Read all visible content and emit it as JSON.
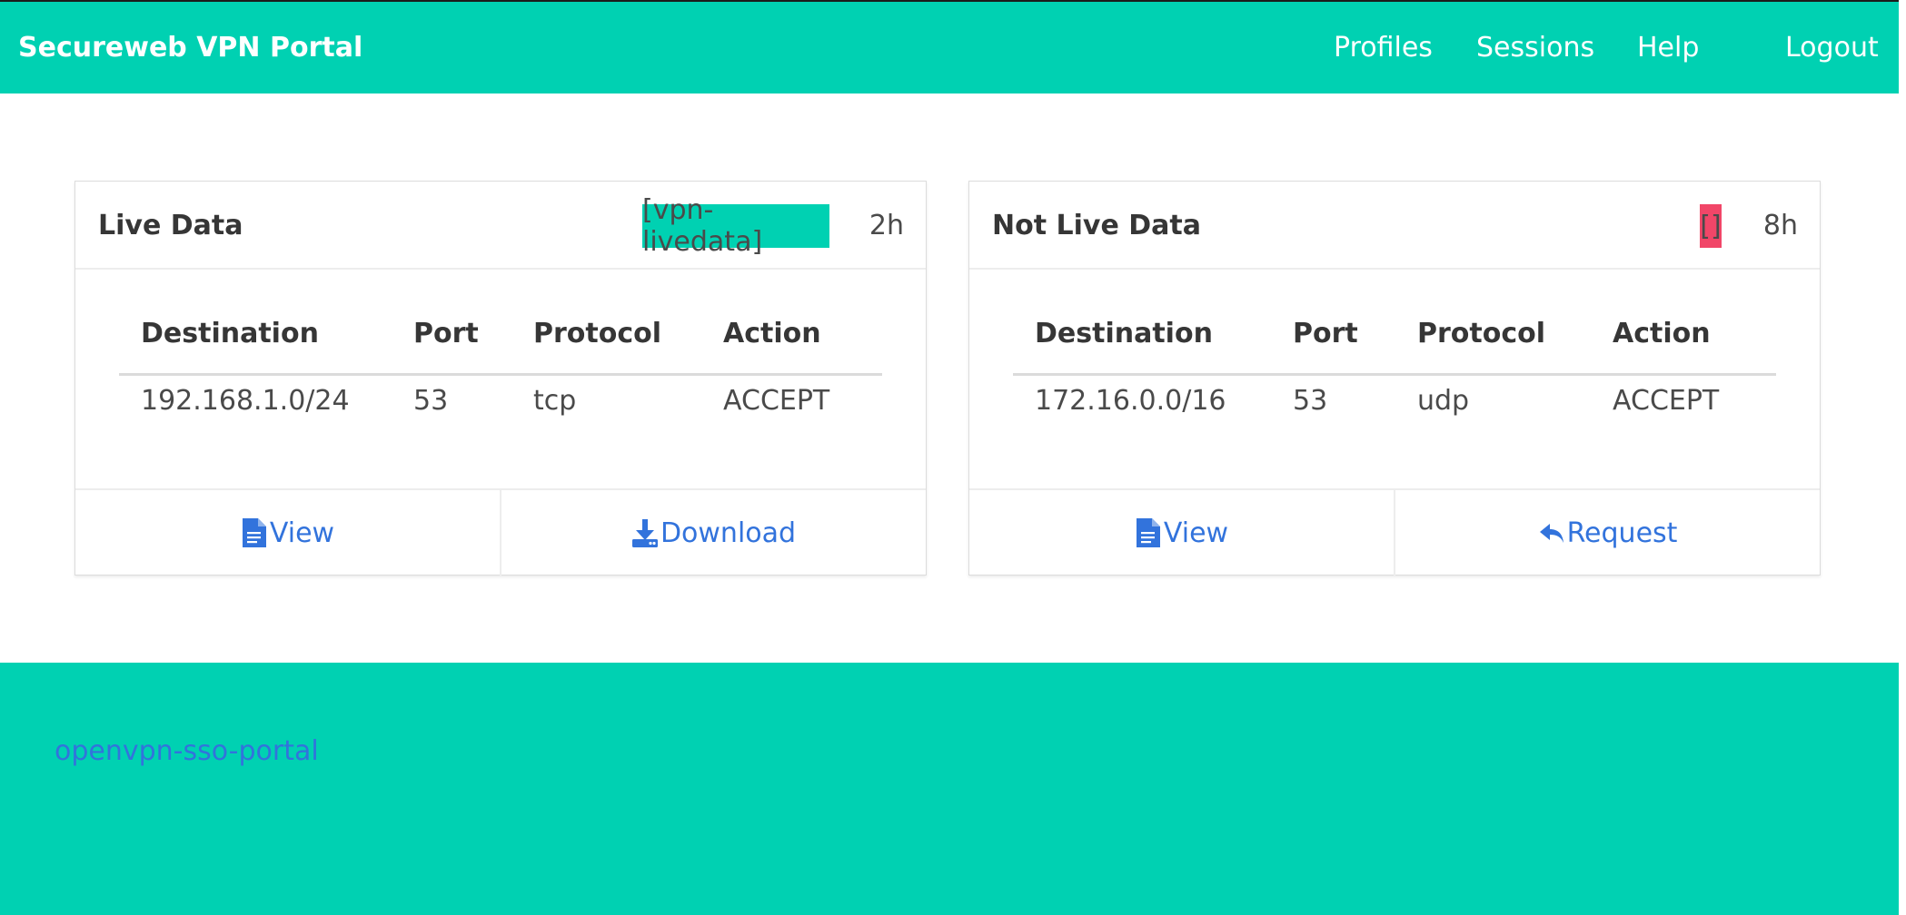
{
  "navbar": {
    "brand": "Secureweb VPN Portal",
    "items": [
      "Profiles",
      "Sessions",
      "Help",
      "Logout"
    ]
  },
  "cards": [
    {
      "title": "Live Data",
      "tag": "[vpn-livedata]",
      "tag_color": "#00d1b2",
      "duration": "2h",
      "columns": [
        "Destination",
        "Port",
        "Protocol",
        "Action"
      ],
      "rows": [
        [
          "192.168.1.0/24",
          "53",
          "tcp",
          "ACCEPT"
        ]
      ],
      "actions": [
        {
          "label": "View",
          "icon": "document-icon"
        },
        {
          "label": "Download",
          "icon": "download-icon"
        }
      ]
    },
    {
      "title": "Not Live Data",
      "tag": "[]",
      "tag_color": "#f14668",
      "duration": "8h",
      "columns": [
        "Destination",
        "Port",
        "Protocol",
        "Action"
      ],
      "rows": [
        [
          "172.16.0.0/16",
          "53",
          "udp",
          "ACCEPT"
        ]
      ],
      "actions": [
        {
          "label": "View",
          "icon": "document-icon"
        },
        {
          "label": "Request",
          "icon": "reply-icon"
        }
      ]
    }
  ],
  "footer": {
    "link": "openvpn-sso-portal"
  },
  "colors": {
    "primary": "#00d1b2",
    "link": "#3273dc",
    "danger": "#f14668"
  }
}
